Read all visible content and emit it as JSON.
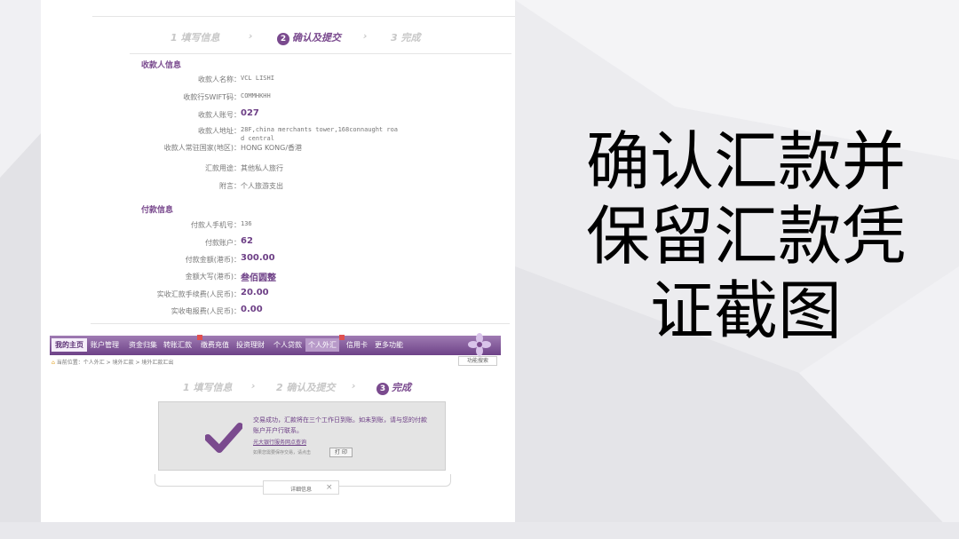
{
  "steps_top": {
    "step1": "1 填写信息",
    "arrow": "›",
    "step2_num": "2",
    "step2": "确认及提交",
    "step3": "3 完成"
  },
  "payee_section": {
    "title": "收款人信息",
    "rows": [
      {
        "label": "收款人名称：",
        "value": "VCL LISHI"
      },
      {
        "label": "收款行SWIFT码：",
        "value": "COMMHKHH"
      },
      {
        "label": "收款人账号：",
        "value": "027"
      },
      {
        "label": "收款人地址：",
        "value": "28F,china merchants tower,168connaught roa"
      },
      {
        "label": "",
        "value": "d central"
      },
      {
        "label": "收款人常驻国家(地区)：",
        "value": "HONG KONG/香港"
      },
      {
        "label": "汇款用途：",
        "value": "其他私人旅行"
      },
      {
        "label": "附言：",
        "value": "个人旅游支出"
      }
    ]
  },
  "payer_section": {
    "title": "付款信息",
    "rows": [
      {
        "label": "付款人手机号：",
        "value": "136"
      },
      {
        "label": "付款账户：",
        "value": "62"
      },
      {
        "label": "付款金额(港币)：",
        "value": "300.00"
      },
      {
        "label": "金额大写(港币)：",
        "value": "叁佰圆整"
      },
      {
        "label": "实收汇款手续费(人民币)：",
        "value": "20.00"
      },
      {
        "label": "实收电报费(人民币)：",
        "value": "0.00"
      }
    ]
  },
  "nav": {
    "items": [
      "我的主页",
      "账户管理",
      "资金归集",
      "转账汇款",
      "缴费充值",
      "投资理财",
      "个人贷款",
      "个人外汇",
      "信用卡",
      "更多功能"
    ],
    "current": "个人外汇"
  },
  "breadcrumb": {
    "text": "当前位置：个人外汇 > 境外汇款 > 境外汇款汇出",
    "button": "功能搜索"
  },
  "steps_bottom": {
    "step1": "1 填写信息",
    "arrow": "›",
    "step2": "2 确认及提交",
    "step3_num": "3",
    "step3": "完成"
  },
  "success": {
    "message": "交易成功，汇款将在三个工作日到账。如未到账，请与您的付款账户开户行联系。",
    "link": "光大银行服务网点查询",
    "hint": "如果您需要保存交易，请点击",
    "print_label": "打 印"
  },
  "detail": {
    "label": "详细信息",
    "close": "×"
  },
  "title_lines": [
    "确认汇款并",
    "保留汇款凭",
    "证截图"
  ],
  "colors": {
    "brand_purple": "#7a4a8e",
    "accent_red": "#e05050"
  }
}
